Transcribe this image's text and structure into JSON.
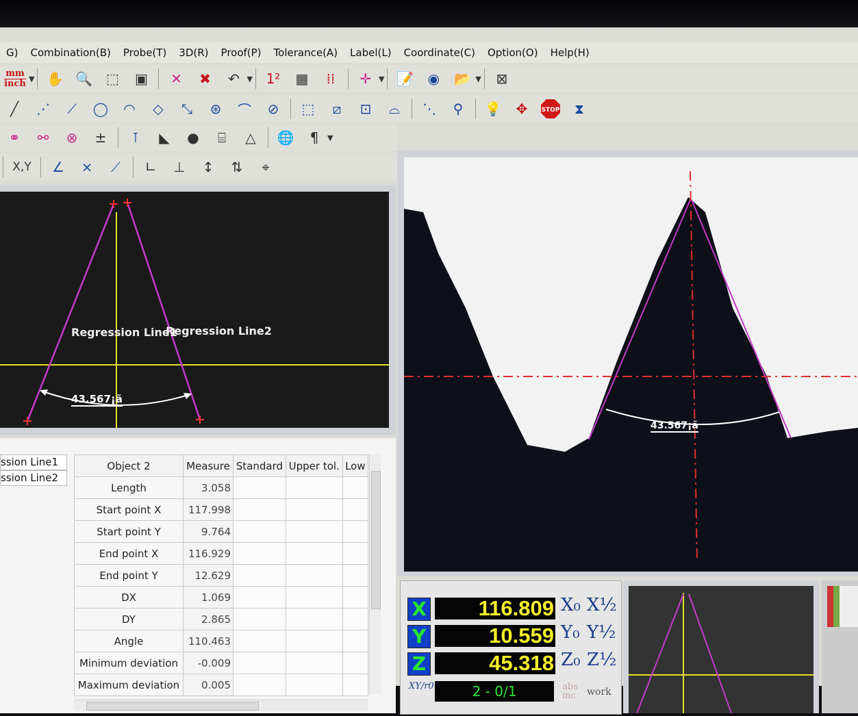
{
  "menu": [
    "G)",
    "Combination(B)",
    "Probe(T)",
    "3D(R)",
    "Proof(P)",
    "Tolerance(A)",
    "Label(L)",
    "Coordinate(C)",
    "Option(O)",
    "Help(H)"
  ],
  "units": {
    "top": "mm",
    "bottom": "inch"
  },
  "toolbar": {
    "coord_label": "X,Y",
    "icons_row1": [
      "hand-icon",
      "zoom-icon",
      "select-box-icon",
      "zoom-window-icon",
      "delete-point-icon",
      "delete-icon",
      "undo-icon",
      "number-order-icon",
      "grid-icon",
      "dot-grid-icon",
      "crosshair-icon",
      "report-icon",
      "camera-icon",
      "open-folder-icon",
      "video-icon"
    ],
    "icons_row2": [
      "line-icon",
      "point-icon",
      "line-measure-icon",
      "circle-icon",
      "arc-icon",
      "rectangle-icon",
      "line-probe-icon",
      "circle-probe-icon",
      "arc-probe-icon",
      "edge-probe-icon",
      "region-icon",
      "diagonal-icon",
      "circle-region-icon",
      "arc-region-icon",
      "scan-icon",
      "search-icon",
      "light-icon",
      "move-icon",
      "stop-icon",
      "focus-icon"
    ],
    "stop_label": "STOP"
  },
  "drawing": {
    "label1": "Regression Line1",
    "label2": "Regression Line2",
    "angle": "43.567¡ã"
  },
  "camera": {
    "angle": "43.567¡ã"
  },
  "objects": [
    "ssion Line1",
    "ssion Line2"
  ],
  "table": {
    "headers": [
      "Object 2",
      "Measure",
      "Standard",
      "Upper tol.",
      "Low"
    ],
    "rows": [
      {
        "label": "Length",
        "measure": "3.058"
      },
      {
        "label": "Start point X",
        "measure": "117.998"
      },
      {
        "label": "Start point Y",
        "measure": "9.764"
      },
      {
        "label": "End point X",
        "measure": "116.929"
      },
      {
        "label": "End point Y",
        "measure": "12.629"
      },
      {
        "label": "DX",
        "measure": "1.069"
      },
      {
        "label": "DY",
        "measure": "2.865"
      },
      {
        "label": "Angle",
        "measure": "110.463"
      },
      {
        "label": "Minimum deviation",
        "measure": "-0.009"
      },
      {
        "label": "Maximum deviation",
        "measure": "0.005"
      }
    ]
  },
  "dro": {
    "x_label": "X",
    "x": "116.809",
    "y_label": "Y",
    "y": "10.559",
    "z_label": "Z",
    "z": "45.318",
    "mode": "2 - 0/1",
    "xyr": "XY/r0",
    "abs": "abs",
    "inc": "inc",
    "work": "work",
    "x0": "X₀",
    "xh": "X½",
    "y0": "Y₀",
    "yh": "Y½",
    "z0": "Z₀",
    "zh": "Z½"
  },
  "colors": {
    "regression": "#c23cc7",
    "axis": "#e0e020",
    "crosshair": "#e03030",
    "dro_text": "#f5ef2a",
    "dro_axis": "#1040c8"
  }
}
